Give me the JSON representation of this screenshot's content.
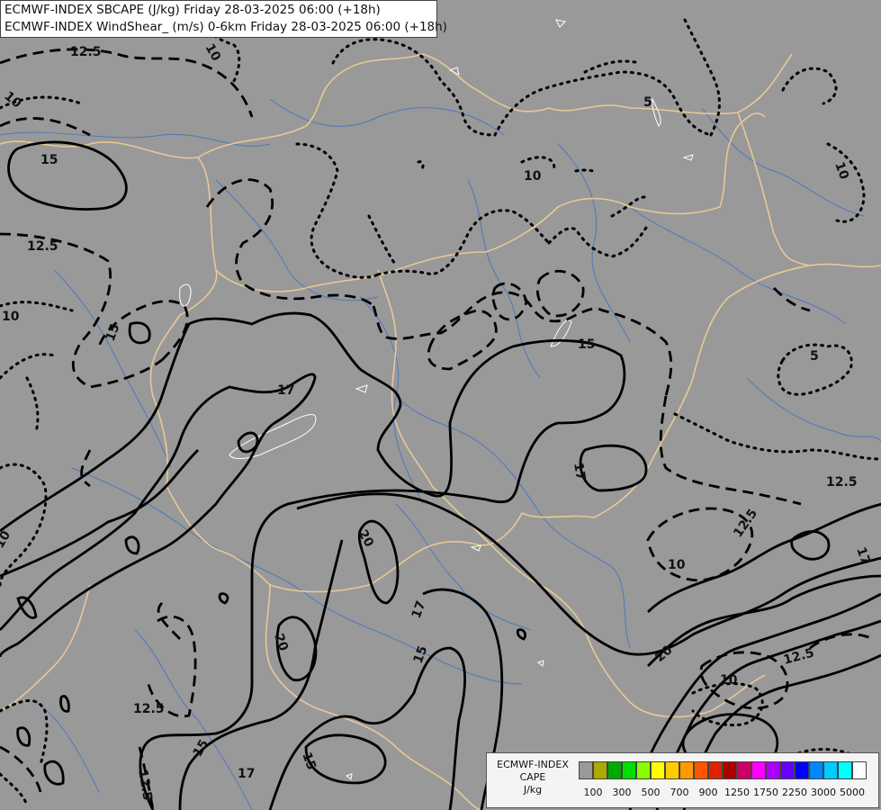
{
  "title": {
    "line1": "ECMWF-INDEX SBCAPE (J/kg) Friday 28-03-2025 06:00 (+18h)",
    "line2": "ECMWF-INDEX WindShear_ (m/s) 0-6km Friday 28-03-2025 06:00 (+18h)"
  },
  "legend": {
    "line1": "ECMWF-INDEX",
    "line2": "CAPE",
    "line3": "J/kg",
    "colors": [
      "#999999",
      "#aaaa00",
      "#00aa00",
      "#00dd00",
      "#88ff00",
      "#ffff00",
      "#ffcc00",
      "#ff9900",
      "#ff5500",
      "#dd2200",
      "#aa0000",
      "#cc0066",
      "#ff00ff",
      "#aa00ff",
      "#6600ff",
      "#0000ff",
      "#0088ff",
      "#00ccff",
      "#00ffff",
      "#ffffff"
    ],
    "ticks": [
      "100",
      "300",
      "500",
      "700",
      "900",
      "1250",
      "1750",
      "2250",
      "3000",
      "5000"
    ]
  },
  "contour_labels": [
    {
      "text": "12.5"
    },
    {
      "text": "10"
    },
    {
      "text": "15"
    },
    {
      "text": "12.5"
    },
    {
      "text": "10"
    },
    {
      "text": "15"
    },
    {
      "text": "17"
    },
    {
      "text": "15"
    },
    {
      "text": "5"
    },
    {
      "text": "10"
    },
    {
      "text": "10"
    },
    {
      "text": "17"
    },
    {
      "text": "5"
    },
    {
      "text": "12.5"
    },
    {
      "text": "12.5"
    },
    {
      "text": "10"
    },
    {
      "text": "17"
    },
    {
      "text": "20"
    },
    {
      "text": "17"
    },
    {
      "text": "15"
    },
    {
      "text": "20"
    },
    {
      "text": "12.5"
    },
    {
      "text": "15"
    },
    {
      "text": "15"
    },
    {
      "text": "17"
    },
    {
      "text": "20"
    },
    {
      "text": "12.5"
    },
    {
      "text": "10"
    },
    {
      "text": "10"
    },
    {
      "text": "12.5"
    },
    {
      "text": "10"
    }
  ]
}
